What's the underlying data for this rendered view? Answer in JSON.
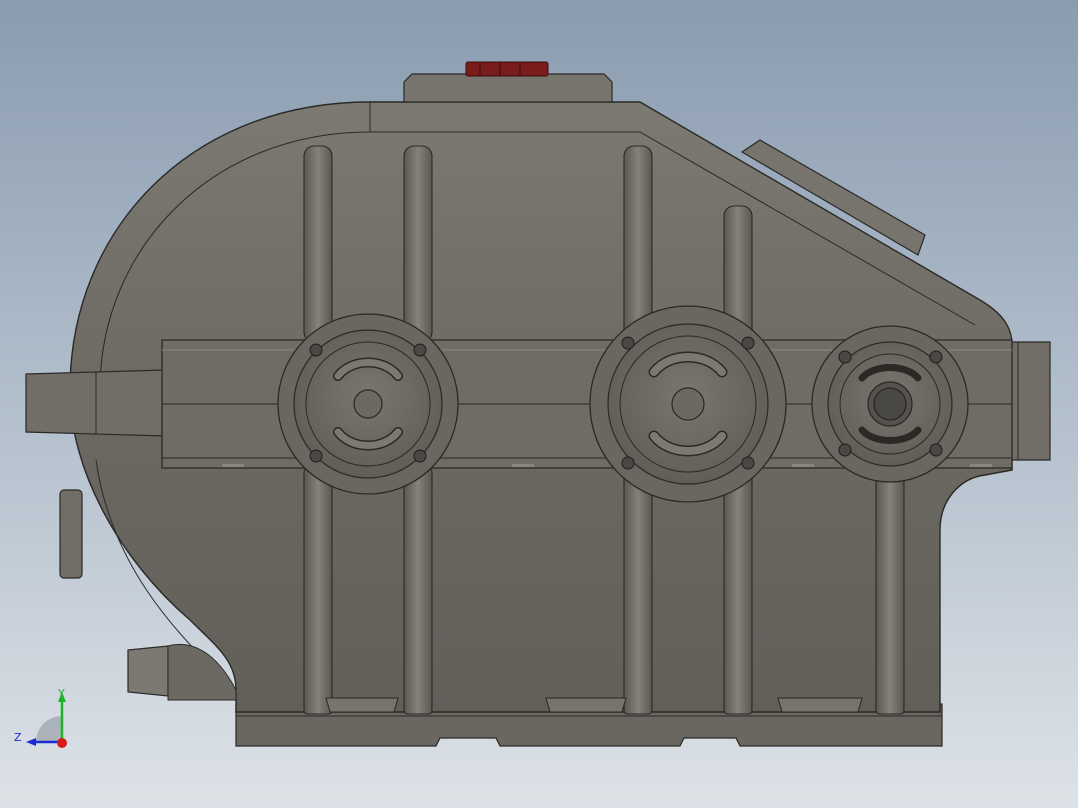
{
  "viewport": {
    "background_top": "#8a9cb0",
    "background_bottom": "#dde2e7"
  },
  "model": {
    "body_color": "#6c6963",
    "edge_color": "#2a2926",
    "highlight_color": "#8a8780",
    "breather_color": "#7a1c1c"
  },
  "triad": {
    "y_label": "Y",
    "z_label": "Z",
    "y_color": "#1fb32a",
    "z_color": "#1a2bd6",
    "x_color": "#d61a1a"
  }
}
